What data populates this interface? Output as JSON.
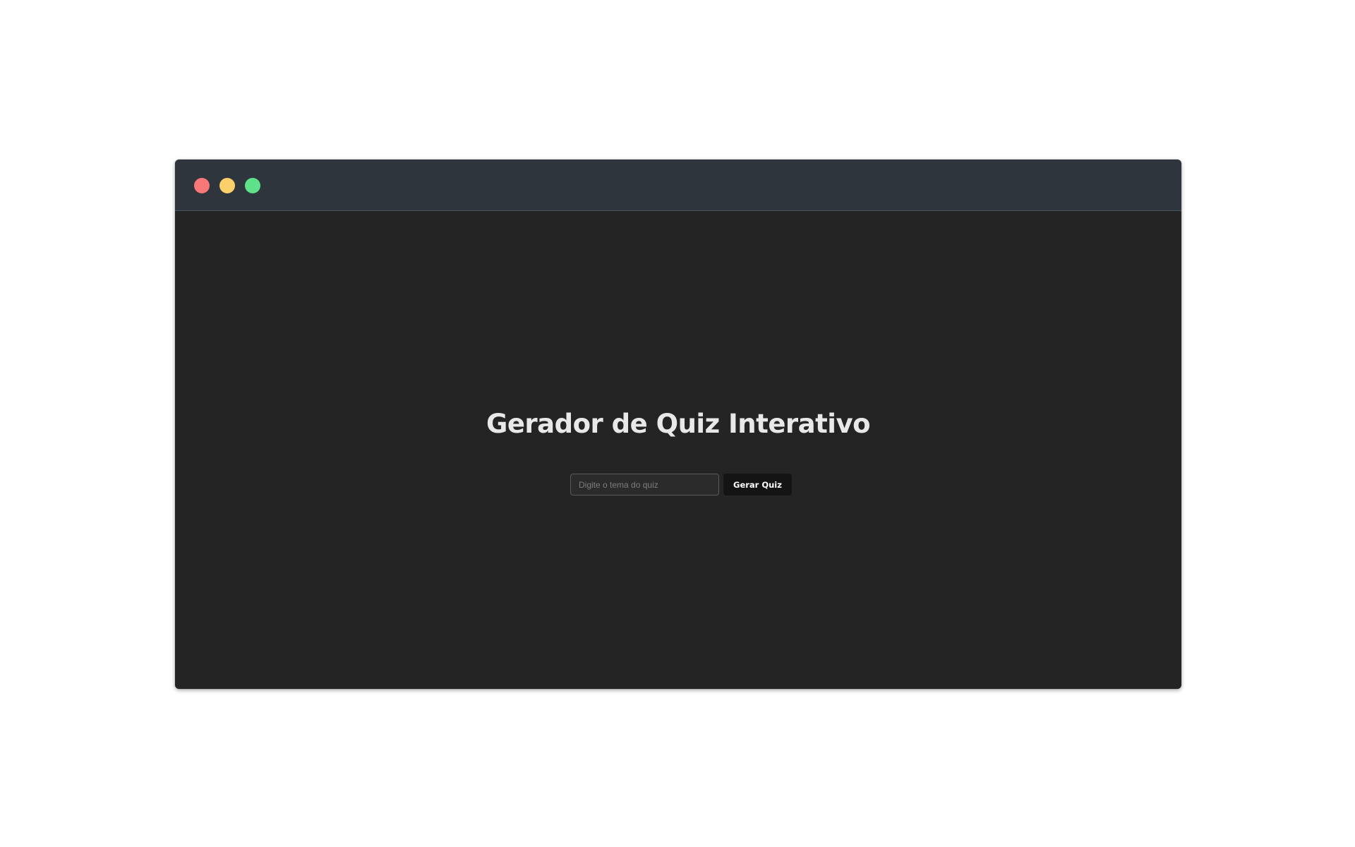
{
  "window": {
    "controls": [
      {
        "name": "close",
        "color": "#f87777"
      },
      {
        "name": "minimize",
        "color": "#fbd06a"
      },
      {
        "name": "maximize",
        "color": "#5fe18a"
      }
    ]
  },
  "main": {
    "title": "Gerador de Quiz Interativo",
    "topic_input": {
      "value": "",
      "placeholder": "Digite o tema do quiz"
    },
    "generate_button_label": "Gerar Quiz"
  },
  "colors": {
    "titlebar_bg": "#2e353d",
    "content_bg": "#242424",
    "button_bg": "#141414",
    "title_text": "#e8e8e8"
  }
}
